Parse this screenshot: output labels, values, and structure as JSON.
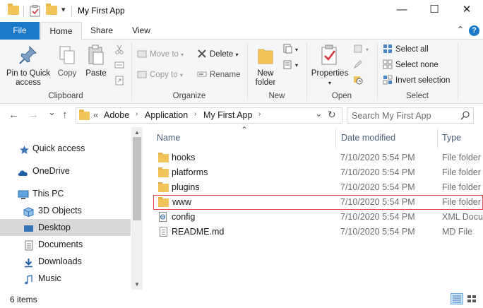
{
  "window": {
    "title": "My First App",
    "minimize_glyph": "—",
    "maximize_glyph": "☐",
    "close_glyph": "✕",
    "quick_access_dropdown_glyph": "▾"
  },
  "ribbon_tabs": {
    "file": "File",
    "home": "Home",
    "share": "Share",
    "view": "View",
    "collapse_glyph": "⌃",
    "help_glyph": "?"
  },
  "ribbon": {
    "clipboard": {
      "label": "Clipboard",
      "pin_label_1": "Pin to Quick",
      "pin_label_2": "access",
      "copy": "Copy",
      "paste": "Paste"
    },
    "organize": {
      "label": "Organize",
      "move_to": "Move to",
      "copy_to": "Copy to",
      "delete": "Delete",
      "rename": "Rename"
    },
    "new": {
      "label": "New",
      "new_folder_1": "New",
      "new_folder_2": "folder"
    },
    "open": {
      "label": "Open",
      "properties": "Properties"
    },
    "select": {
      "label": "Select",
      "select_all": "Select all",
      "select_none": "Select none",
      "invert_selection": "Invert selection"
    }
  },
  "navigation": {
    "back_glyph": "←",
    "forward_glyph": "→",
    "recent_glyph": "⌄",
    "up_glyph": "↑",
    "overflow_glyph": "«",
    "breadcrumbs": [
      "Adobe",
      "Application",
      "My First App"
    ],
    "separator_glyph": "›",
    "refresh_glyph": "↻",
    "address_dropdown_glyph": "⌄",
    "search_placeholder": "Search My First App",
    "search_icon": "magnifier-icon"
  },
  "nav_pane": {
    "items": [
      {
        "label": "Quick access",
        "icon": "star-icon"
      },
      {
        "label": "OneDrive",
        "icon": "cloud-icon"
      },
      {
        "label": "This PC",
        "icon": "computer-icon"
      },
      {
        "label": "3D Objects",
        "icon": "cube-icon"
      },
      {
        "label": "Desktop",
        "icon": "desktop-icon"
      },
      {
        "label": "Documents",
        "icon": "documents-icon"
      },
      {
        "label": "Downloads",
        "icon": "download-icon"
      },
      {
        "label": "Music",
        "icon": "music-icon"
      }
    ],
    "selected": "Desktop",
    "scroll_up_glyph": "▲",
    "scroll_down_glyph": "▼"
  },
  "file_list": {
    "sort_glyph": "⌃",
    "columns": {
      "name": "Name",
      "date": "Date modified",
      "type": "Type"
    },
    "rows": [
      {
        "name": "hooks",
        "date": "7/10/2020 5:54 PM",
        "type": "File folder",
        "icon": "folder-icon"
      },
      {
        "name": "platforms",
        "date": "7/10/2020 5:54 PM",
        "type": "File folder",
        "icon": "folder-icon"
      },
      {
        "name": "plugins",
        "date": "7/10/2020 5:54 PM",
        "type": "File folder",
        "icon": "folder-icon"
      },
      {
        "name": "www",
        "date": "7/10/2020 5:54 PM",
        "type": "File folder",
        "icon": "folder-icon"
      },
      {
        "name": "config",
        "date": "7/10/2020 5:54 PM",
        "type": "XML Docu",
        "icon": "xml-file-icon"
      },
      {
        "name": "README.md",
        "date": "7/10/2020 5:54 PM",
        "type": "MD File",
        "icon": "text-file-icon"
      }
    ],
    "highlighted_row": "www"
  },
  "status_bar": {
    "item_count": "6 items"
  },
  "colors": {
    "accent": "#1979ca",
    "folder": "#f2c55c",
    "highlight_border": "#e04848",
    "selected_nav": "#d9d9d9"
  }
}
